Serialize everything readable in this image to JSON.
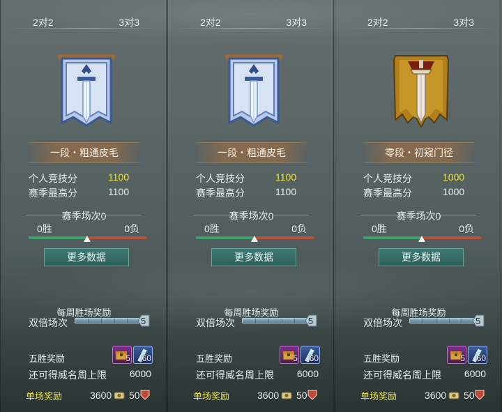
{
  "panels": [
    {
      "tab_left": "2对2",
      "tab_right": "3对3",
      "emblem": "blue-sword-banner",
      "rank": "一段・粗通皮毛",
      "score_label": "个人竞技分",
      "score_value": "1100",
      "best_label": "赛季最高分",
      "best_value": "1100",
      "season_title": "赛季场次0",
      "wins": "0胜",
      "losses": "0负",
      "more_label": "更多数据",
      "weekly_title": "每周胜场奖励",
      "double_label": "双倍场次",
      "double_count": "5",
      "five_label": "五胜奖励",
      "chest_count": "5",
      "gem_count": "60",
      "limit_label": "还可得威名周上限",
      "limit_value": "6000",
      "single_label": "单场奖励",
      "single_coin": "3600",
      "single_other": "50"
    },
    {
      "tab_left": "2对2",
      "tab_right": "3对3",
      "emblem": "blue-sword-banner",
      "rank": "一段・粗通皮毛",
      "score_label": "个人竞技分",
      "score_value": "1100",
      "best_label": "赛季最高分",
      "best_value": "1100",
      "season_title": "赛季场次0",
      "wins": "0胜",
      "losses": "0负",
      "more_label": "更多数据",
      "weekly_title": "每周胜场奖励",
      "double_label": "双倍场次",
      "double_count": "5",
      "five_label": "五胜奖励",
      "chest_count": "5",
      "gem_count": "60",
      "limit_label": "还可得威名周上限",
      "limit_value": "6000",
      "single_label": "单场奖励",
      "single_coin": "3600",
      "single_other": "50"
    },
    {
      "tab_left": "2对2",
      "tab_right": "3对3",
      "emblem": "gold-sword-banner",
      "rank": "零段・初窥门径",
      "score_label": "个人竞技分",
      "score_value": "1000",
      "best_label": "赛季最高分",
      "best_value": "1000",
      "season_title": "赛季场次0",
      "wins": "0胜",
      "losses": "0负",
      "more_label": "更多数据",
      "weekly_title": "每周胜场奖励",
      "double_label": "双倍场次",
      "double_count": "5",
      "five_label": "五胜奖励",
      "chest_count": "5",
      "gem_count": "60",
      "limit_label": "还可得威名周上限",
      "limit_value": "6000",
      "single_label": "单场奖励",
      "single_coin": "3600",
      "single_other": "50"
    }
  ],
  "colors": {
    "highlight": "#f0e23a",
    "win_bar": "#3aa06a",
    "loss_bar": "#b4523a",
    "button": "#2c605a"
  }
}
